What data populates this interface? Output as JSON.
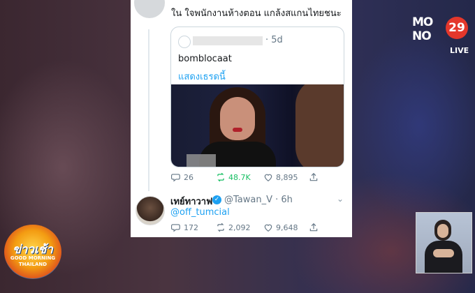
{
  "reply_tweet": {
    "text": "ใน ใจพนักงานห้างตอน แกล้งสแกนไทยชนะ"
  },
  "quoted_tweet": {
    "time": "· 5d",
    "text": "bomblocaat",
    "show_thread_link": "แสดงเธรดนี้"
  },
  "reply_actions": {
    "replies": "26",
    "retweets": "48.7K",
    "likes": "8,895"
  },
  "second_tweet": {
    "name": "เทย์ทาวาฟ",
    "handle_time": "@Tawan_V · 6h",
    "mention": "@off_tumcial",
    "replies": "172",
    "retweets": "2,092",
    "likes": "9,648"
  },
  "channel": {
    "logo_text_1": "MO",
    "logo_text_2": "NO",
    "logo_number": "29",
    "live_label": "LIVE"
  },
  "show": {
    "title": "ข่าวเช้า",
    "sub1": "GOOD MORNING",
    "sub2": "THAILAND"
  },
  "colors": {
    "link": "#1da1f2",
    "retweet_active": "#17bf63",
    "channel_accent": "#e4372b"
  }
}
